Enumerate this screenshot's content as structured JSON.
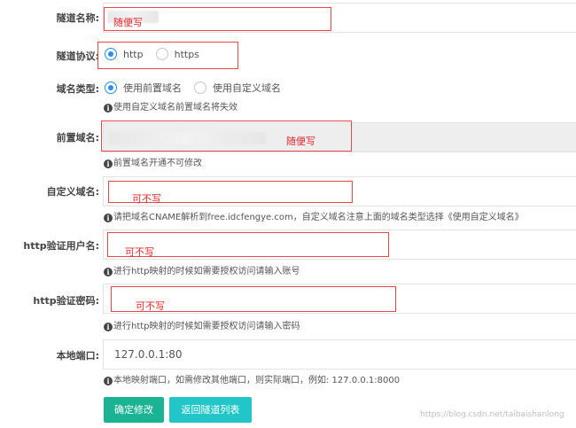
{
  "form": {
    "tunnel_name": {
      "label": "隧道名称:",
      "annotation": "随便写"
    },
    "tunnel_protocol": {
      "label": "隧道协议:",
      "options": [
        "http",
        "https"
      ],
      "selected": "http"
    },
    "domain_type": {
      "label": "域名类型:",
      "options": [
        "使用前置域名",
        "使用自定义域名"
      ],
      "selected": "使用前置域名",
      "hint": "使用自定义域名前置域名将失效"
    },
    "front_domain": {
      "label": "前置域名:",
      "annotation": "随便写",
      "hint": "前置域名开通不可修改"
    },
    "custom_domain": {
      "label": "自定义域名:",
      "annotation": "可不写",
      "hint": "请把域名CNAME解析到free.idcfengye.com，自定义域名注意上面的域名类型选择《使用自定义域名》"
    },
    "http_username": {
      "label": "http验证用户名:",
      "annotation": "可不写",
      "hint": "进行http映射的时候如需要授权访问请输入账号"
    },
    "http_password": {
      "label": "http验证密码:",
      "annotation": "可不写",
      "hint": "进行http映射的时候如需要授权访问请输入密码"
    },
    "local_port": {
      "label": "本地端口:",
      "value": "127.0.0.1:80",
      "hint": "本地映射端口，如需修改其他端口，则实际端口，例如:  127.0.0.1:8000"
    }
  },
  "buttons": {
    "confirm": "确定修改",
    "back": "返回隧道列表"
  },
  "watermark": "https://blog.csdn.net/taibaishanlong",
  "colors": {
    "annotation_red": "#e8474b",
    "radio_blue": "#2d8cf0",
    "primary_green": "#1ab394",
    "info_teal": "#23c6c8"
  }
}
